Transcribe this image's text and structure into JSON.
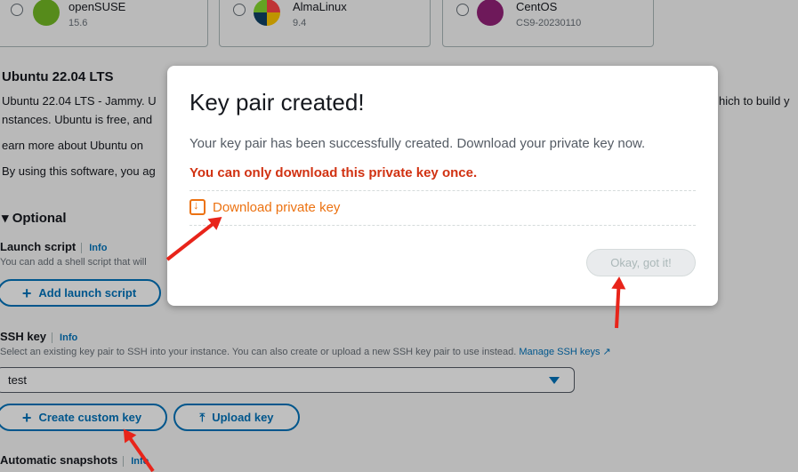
{
  "os_options": [
    {
      "name": "openSUSE",
      "version": "15.6",
      "color": "#73ba25"
    },
    {
      "name": "AlmaLinux",
      "version": "9.4",
      "color": "#ff4649"
    },
    {
      "name": "CentOS",
      "version": "CS9-20230110",
      "color": "#932279"
    }
  ],
  "blueprint": {
    "title": "Ubuntu 22.04 LTS",
    "desc_line1": "Ubuntu 22.04 LTS - Jammy. U",
    "desc_line1_right": "hich to build y",
    "desc_line2": "nstances. Ubuntu is free, and",
    "learn_more": "earn more about Ubuntu on",
    "agree": "By using this software, you ag"
  },
  "optional": {
    "label": "Optional",
    "launch_script": {
      "label": "Launch script",
      "info": "Info",
      "desc": "You can add a shell script that will",
      "button": "Add launch script"
    },
    "ssh_key": {
      "label": "SSH key",
      "info": "Info",
      "desc": "Select an existing key pair to SSH into your instance. You can also create or upload a new SSH key pair to use instead.",
      "manage_link": "Manage SSH keys",
      "selected": "test",
      "create_button": "Create custom key",
      "upload_button": "Upload key"
    },
    "snapshots": {
      "label": "Automatic snapshots",
      "info": "Info"
    }
  },
  "modal": {
    "title": "Key pair created!",
    "message": "Your key pair has been successfully created. Download your private key now.",
    "warning": "You can only download this private key once.",
    "download_link": "Download private key",
    "ok_button": "Okay, got it!"
  },
  "colors": {
    "accent": "#0073bb",
    "warning": "#d13212",
    "link_orange": "#ec7211",
    "arrow": "#e8241a"
  }
}
